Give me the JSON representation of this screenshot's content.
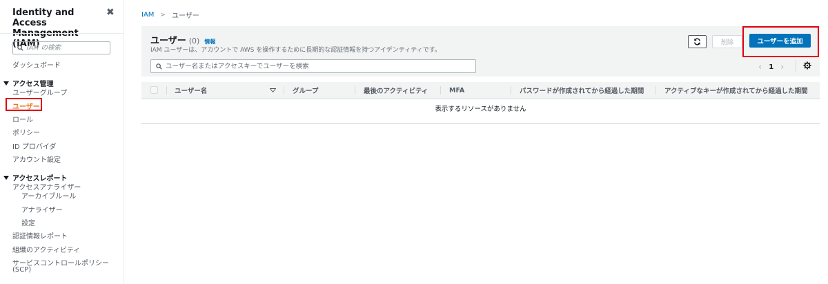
{
  "sidebar": {
    "title": "Identity and Access Management (IAM)",
    "search_placeholder": "IAM の検索",
    "dashboard": "ダッシュボード",
    "access_management": {
      "label": "アクセス管理",
      "items": [
        "ユーザーグループ",
        "ユーザー",
        "ロール",
        "ポリシー",
        "ID プロバイダ",
        "アカウント設定"
      ]
    },
    "access_reports": {
      "label": "アクセスレポート",
      "items": [
        "アクセスアナライザー",
        "アーカイブルール",
        "アナライザー",
        "設定",
        "認証情報レポート",
        "組織のアクティビティ",
        "サービスコントロールポリシー",
        "(SCP)"
      ]
    }
  },
  "breadcrumb": {
    "root": "IAM",
    "current": "ユーザー"
  },
  "panel": {
    "title": "ユーザー",
    "count": "(0)",
    "info": "情報",
    "description": "IAM ユーザーは、アカウントで AWS を操作するために長期的な認証情報を持つアイデンティティです。",
    "search_placeholder": "ユーザー名またはアクセスキーでユーザーを検索",
    "delete_label": "削除",
    "add_label": "ユーザーを追加",
    "page": "1"
  },
  "table": {
    "columns": [
      "ユーザー名",
      "グループ",
      "最後のアクティビティ",
      "MFA",
      "パスワードが作成されてから経過した期間",
      "アクティブなキーが作成されてから経過した期間"
    ],
    "empty_message": "表示するリソースがありません"
  },
  "colors": {
    "accent": "#ec7211",
    "primary": "#0073bb",
    "highlight": "#e0000e"
  }
}
